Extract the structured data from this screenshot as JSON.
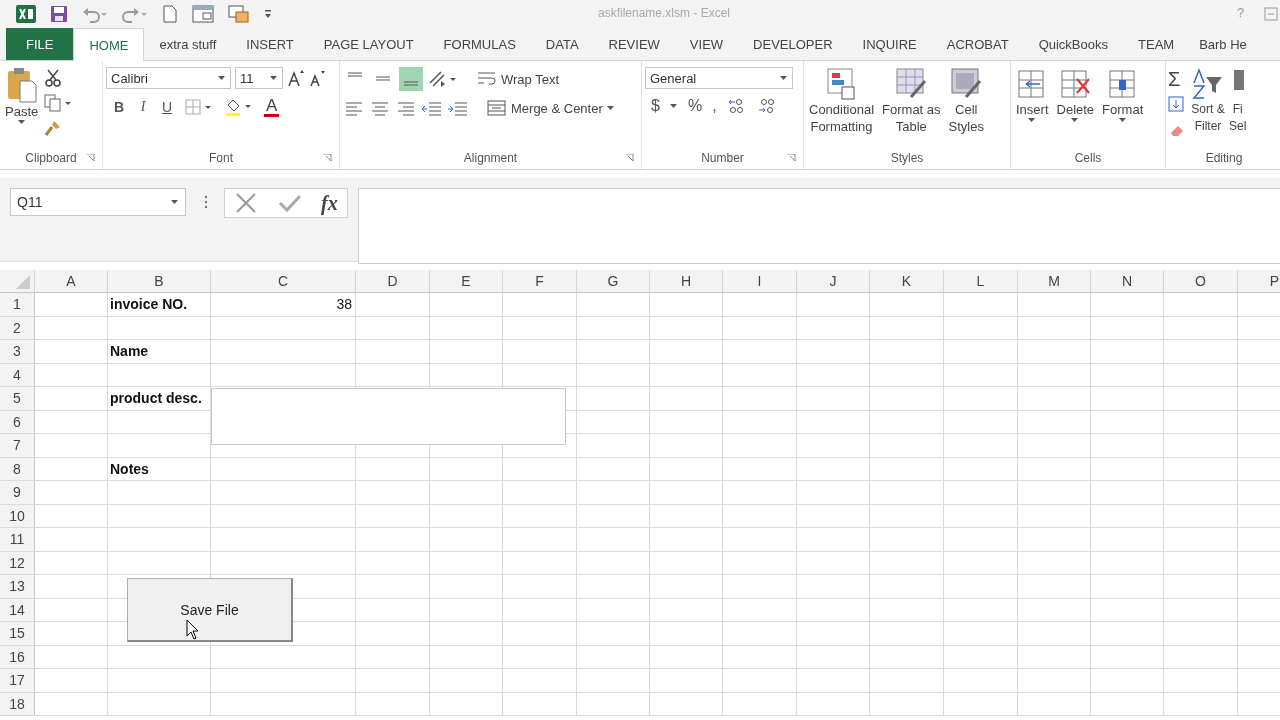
{
  "window": {
    "title": "askfilename.xlsm - Excel",
    "help": "?"
  },
  "tabs": [
    {
      "label": "FILE",
      "kind": "file",
      "selected": false
    },
    {
      "label": "HOME",
      "kind": "tab",
      "selected": true
    },
    {
      "label": "extra stuff",
      "kind": "tab",
      "selected": false
    },
    {
      "label": "INSERT",
      "kind": "tab",
      "selected": false
    },
    {
      "label": "PAGE LAYOUT",
      "kind": "tab",
      "selected": false
    },
    {
      "label": "FORMULAS",
      "kind": "tab",
      "selected": false
    },
    {
      "label": "DATA",
      "kind": "tab",
      "selected": false
    },
    {
      "label": "REVIEW",
      "kind": "tab",
      "selected": false
    },
    {
      "label": "VIEW",
      "kind": "tab",
      "selected": false
    },
    {
      "label": "DEVELOPER",
      "kind": "tab",
      "selected": false
    },
    {
      "label": "INQUIRE",
      "kind": "tab",
      "selected": false
    },
    {
      "label": "ACROBAT",
      "kind": "tab",
      "selected": false
    },
    {
      "label": "QuickBooks",
      "kind": "tab",
      "selected": false
    },
    {
      "label": "TEAM",
      "kind": "tab",
      "selected": false
    },
    {
      "label": "Barb He",
      "kind": "user",
      "selected": false
    }
  ],
  "ribbon": {
    "clipboard": {
      "title": "Clipboard",
      "paste": "Paste"
    },
    "font": {
      "title": "Font",
      "family": "Calibri",
      "size": "11",
      "bold": "B",
      "italic": "I",
      "underline": "U",
      "color_letter": "A"
    },
    "alignment": {
      "title": "Alignment",
      "wrap": "Wrap Text",
      "merge": "Merge & Center",
      "vertical": [
        {
          "selected": false
        },
        {
          "selected": false
        },
        {
          "selected": true
        }
      ]
    },
    "number": {
      "title": "Number",
      "format": "General",
      "currency": "$",
      "percent": "%",
      "comma": ","
    },
    "styles": {
      "title": "Styles",
      "buttons": [
        {
          "lines": [
            "Conditional",
            "Formatting"
          ]
        },
        {
          "lines": [
            "Format as",
            "Table"
          ]
        },
        {
          "lines": [
            "Cell",
            "Styles"
          ]
        }
      ]
    },
    "cells": {
      "title": "Cells",
      "buttons": [
        {
          "label": "Insert"
        },
        {
          "label": "Delete"
        },
        {
          "label": "Format"
        }
      ]
    },
    "editing": {
      "title": "Editing",
      "sum": "Σ",
      "buttons": [
        {
          "lines": [
            "Sort &",
            "Filter"
          ]
        },
        {
          "lines": [
            "Fi",
            "Sel"
          ]
        }
      ]
    }
  },
  "formula_bar": {
    "name_box": "Q11",
    "fx": "fx"
  },
  "sheet": {
    "columns": [
      "A",
      "B",
      "C",
      "D",
      "E",
      "F",
      "G",
      "H",
      "I",
      "J",
      "K",
      "L",
      "M",
      "N",
      "O",
      "P"
    ],
    "rows": [
      {
        "number": "1",
        "label": "invoice NO.",
        "value": "38"
      },
      {
        "number": "2"
      },
      {
        "number": "3",
        "label": "Name"
      },
      {
        "number": "4"
      },
      {
        "number": "5",
        "label": "product desc."
      },
      {
        "number": "6"
      },
      {
        "number": "7"
      },
      {
        "number": "8",
        "label": "Notes"
      },
      {
        "number": "9"
      },
      {
        "number": "10"
      },
      {
        "number": "11"
      },
      {
        "number": "12"
      },
      {
        "number": "13"
      },
      {
        "number": "14"
      },
      {
        "number": "15"
      },
      {
        "number": "16"
      },
      {
        "number": "17"
      },
      {
        "number": "18"
      }
    ],
    "button": {
      "label": "Save File"
    }
  }
}
